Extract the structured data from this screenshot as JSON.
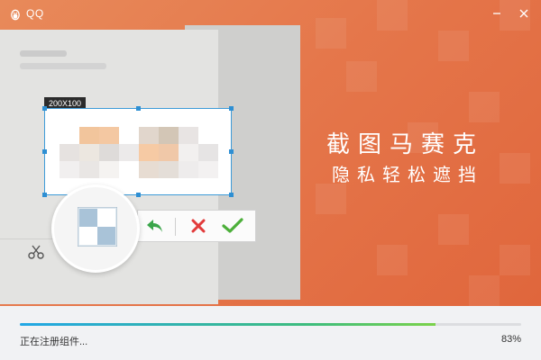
{
  "window": {
    "title": "QQ"
  },
  "banner": {
    "slogan_line1": "截图马赛克",
    "slogan_line2": "隐私轻松遮挡",
    "selection_size_label": "200X100"
  },
  "toolbar": {
    "undo_icon": "undo-arrow-icon",
    "cancel_icon": "cross-icon",
    "confirm_icon": "check-icon"
  },
  "footer": {
    "status_text": "正在注册组件...",
    "progress_percent_text": "83%",
    "progress_fraction": 0.83
  },
  "colors": {
    "banner_orange": "#e5774b",
    "selection_blue": "#3d9bd8",
    "undo_green": "#3aa54a",
    "cancel_red": "#e23b3b",
    "confirm_green": "#4caf3a"
  }
}
